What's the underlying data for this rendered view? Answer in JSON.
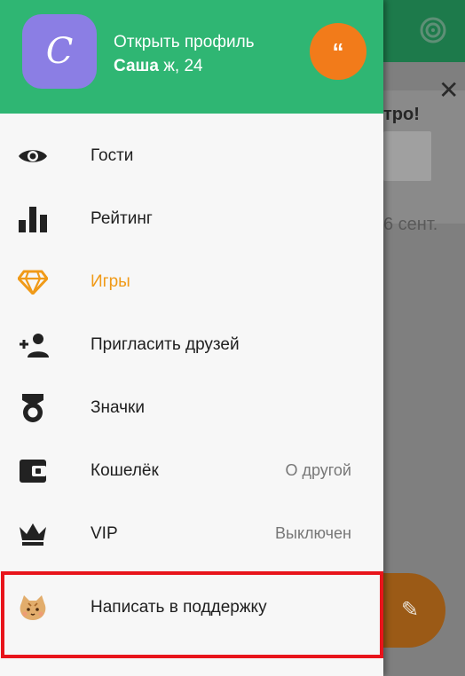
{
  "profile": {
    "avatar_letter": "С",
    "open_label": "Открыть профиль",
    "name": "Саша",
    "details": " ж, 24",
    "quote_glyph": "“"
  },
  "menu": {
    "items": [
      {
        "label": "Гости",
        "value": "",
        "icon": "eye-icon"
      },
      {
        "label": "Рейтинг",
        "value": "",
        "icon": "bar-chart-icon"
      },
      {
        "label": "Игры",
        "value": "",
        "icon": "diamond-icon"
      },
      {
        "label": "Пригласить друзей",
        "value": "",
        "icon": "add-person-icon"
      },
      {
        "label": "Значки",
        "value": "",
        "icon": "badge-icon"
      },
      {
        "label": "Кошелёк",
        "value": "О другой",
        "icon": "wallet-icon"
      },
      {
        "label": "VIP",
        "value": "Выключен",
        "icon": "crown-icon"
      },
      {
        "label": "Написать в поддержку",
        "value": "",
        "icon": "support-cat-icon"
      }
    ]
  },
  "background": {
    "snippet": "тро!",
    "date": "6 сент."
  },
  "colors": {
    "header_green": "#2fb673",
    "accent_orange": "#f27b1a",
    "games_orange": "#f09a18",
    "avatar_purple": "#8b7ee4",
    "highlight_red": "#e8141b"
  }
}
